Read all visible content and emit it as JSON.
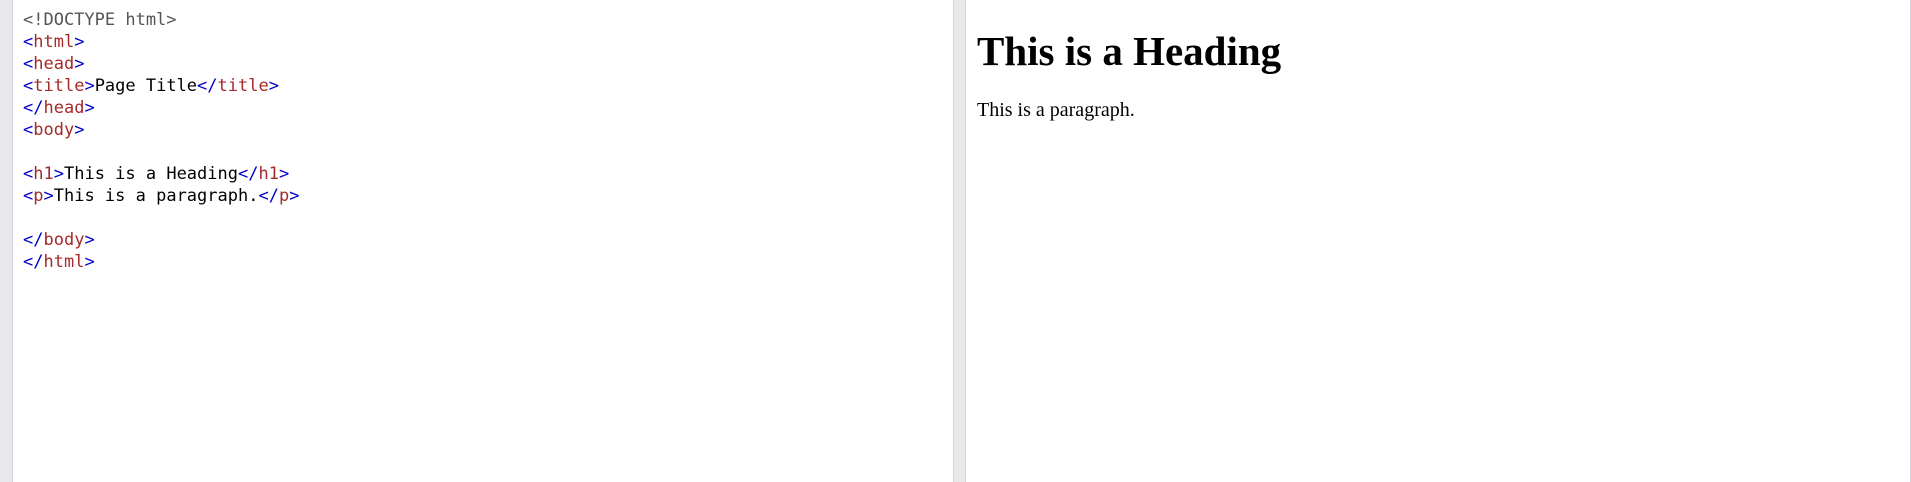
{
  "editor": {
    "lines": [
      [
        {
          "t": "doctype",
          "v": "<!DOCTYPE html>"
        }
      ],
      [
        {
          "t": "bracket",
          "v": "<"
        },
        {
          "t": "tag",
          "v": "html"
        },
        {
          "t": "bracket",
          "v": ">"
        }
      ],
      [
        {
          "t": "bracket",
          "v": "<"
        },
        {
          "t": "tag",
          "v": "head"
        },
        {
          "t": "bracket",
          "v": ">"
        }
      ],
      [
        {
          "t": "bracket",
          "v": "<"
        },
        {
          "t": "tag",
          "v": "title"
        },
        {
          "t": "bracket",
          "v": ">"
        },
        {
          "t": "text",
          "v": "Page Title"
        },
        {
          "t": "bracket",
          "v": "</"
        },
        {
          "t": "tag",
          "v": "title"
        },
        {
          "t": "bracket",
          "v": ">"
        }
      ],
      [
        {
          "t": "bracket",
          "v": "</"
        },
        {
          "t": "tag",
          "v": "head"
        },
        {
          "t": "bracket",
          "v": ">"
        }
      ],
      [
        {
          "t": "bracket",
          "v": "<"
        },
        {
          "t": "tag",
          "v": "body"
        },
        {
          "t": "bracket",
          "v": ">"
        }
      ],
      [],
      [
        {
          "t": "bracket",
          "v": "<"
        },
        {
          "t": "tag",
          "v": "h1"
        },
        {
          "t": "bracket",
          "v": ">"
        },
        {
          "t": "text",
          "v": "This is a Heading"
        },
        {
          "t": "bracket",
          "v": "</"
        },
        {
          "t": "tag",
          "v": "h1"
        },
        {
          "t": "bracket",
          "v": ">"
        }
      ],
      [
        {
          "t": "bracket",
          "v": "<"
        },
        {
          "t": "tag",
          "v": "p"
        },
        {
          "t": "bracket",
          "v": ">"
        },
        {
          "t": "text",
          "v": "This is a paragraph."
        },
        {
          "t": "bracket",
          "v": "</"
        },
        {
          "t": "tag",
          "v": "p"
        },
        {
          "t": "bracket",
          "v": ">"
        }
      ],
      [],
      [
        {
          "t": "bracket",
          "v": "</"
        },
        {
          "t": "tag",
          "v": "body"
        },
        {
          "t": "bracket",
          "v": ">"
        }
      ],
      [
        {
          "t": "bracket",
          "v": "</"
        },
        {
          "t": "tag",
          "v": "html"
        },
        {
          "t": "bracket",
          "v": ">"
        }
      ]
    ],
    "colors": {
      "doctype": "#555555",
      "bracket": "#0000cd",
      "tag": "#a52a2a",
      "text": "#000000"
    }
  },
  "result": {
    "heading": "This is a Heading",
    "paragraph": "This is a paragraph."
  }
}
